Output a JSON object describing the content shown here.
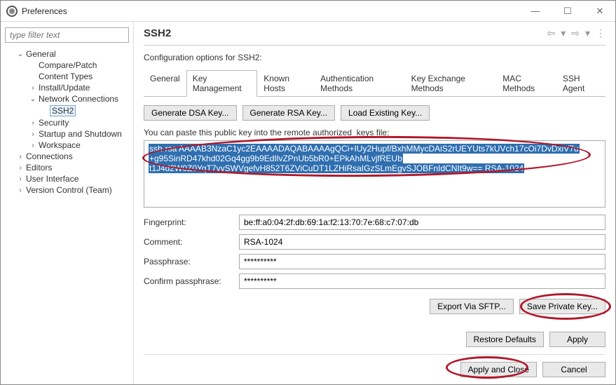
{
  "window": {
    "title": "Preferences",
    "min_icon": "—",
    "max_icon": "☐",
    "close_icon": "✕"
  },
  "filter_placeholder": "type filter text",
  "tree": {
    "general": "General",
    "compare": "Compare/Patch",
    "content": "Content Types",
    "install": "Install/Update",
    "network": "Network Connections",
    "ssh2": "SSH2",
    "security": "Security",
    "startup": "Startup and Shutdown",
    "workspace": "Workspace",
    "connections": "Connections",
    "editors": "Editors",
    "ui": "User Interface",
    "vc": "Version Control (Team)"
  },
  "header": {
    "title": "SSH2"
  },
  "desc": "Configuration options for SSH2:",
  "tabs": [
    "General",
    "Key Management",
    "Known Hosts",
    "Authentication Methods",
    "Key Exchange Methods",
    "MAC Methods",
    "SSH Agent"
  ],
  "gen": {
    "dsa": "Generate DSA Key...",
    "rsa": "Generate RSA Key...",
    "load": "Load Existing Key..."
  },
  "hint": "You can paste this public key into the remote authorized_keys file:",
  "pubkey_lines": [
    "ssh-rsa AAAAB3NzaC1yc2EAAAADAQABAAAAgQCi+IUy2Hupf/BxhMMycDAiS2rUEYUts7kUVch17cOi7DvDxiV7u",
    "+g95SinRD47khd02Gq4gg9b9EdIlvZPnUb5bR0+EPkAhMLvjfREUb",
    "t1J4d2W0Z0YqT7vySWVgefvH852T6ZViCuDT1LZHiRsaIGzSLmEgvSJOBFnIdCNIt9w== RSA-1024"
  ],
  "fields": {
    "fingerprint_label": "Fingerprint:",
    "fingerprint": "be:ff:a0:04:2f:db:69:1a:f2:13:70:7e:68:c7:07:db",
    "comment_label": "Comment:",
    "comment": "RSA-1024",
    "pass_label": "Passphrase:",
    "pass": "**********",
    "cpass_label": "Confirm passphrase:",
    "cpass": "**********"
  },
  "export": {
    "sftp": "Export Via SFTP...",
    "save": "Save Private Key..."
  },
  "bottom": {
    "restore": "Restore Defaults",
    "apply": "Apply"
  },
  "footer": {
    "apply_close": "Apply and Close",
    "cancel": "Cancel"
  }
}
